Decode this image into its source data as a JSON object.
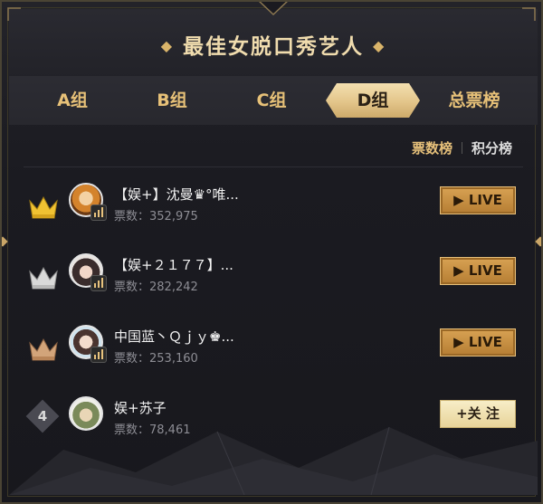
{
  "title": "最佳女脱口秀艺人",
  "tabs": [
    {
      "label": "A组",
      "active": false
    },
    {
      "label": "B组",
      "active": false
    },
    {
      "label": "C组",
      "active": false
    },
    {
      "label": "D组",
      "active": true
    },
    {
      "label": "总票榜",
      "active": false
    }
  ],
  "subtabs": [
    {
      "label": "票数榜",
      "active": true
    },
    {
      "label": "积分榜",
      "active": false
    }
  ],
  "colors": {
    "gold": "#e7c178",
    "gold_rank": "#f0c232",
    "silver_rank": "#d9d9d9",
    "bronze_rank": "#d2a47a"
  },
  "entries": [
    {
      "rank": "1",
      "rank_icon": "crown-gold-icon",
      "name": "【娱+】沈曼♛°唯...",
      "votes_label": "票数：352,975",
      "button": "LIVE"
    },
    {
      "rank": "2",
      "rank_icon": "crown-silver-icon",
      "name": "【娱+２１７７】...",
      "votes_label": "票数：282,242",
      "button": "LIVE"
    },
    {
      "rank": "3",
      "rank_icon": "crown-bronze-icon",
      "name": "中国蓝丶Ｑｊｙ♚...",
      "votes_label": "票数：253,160",
      "button": "LIVE"
    },
    {
      "rank": "4",
      "rank_icon": "rank-diamond-icon",
      "name": "娱+苏子",
      "votes_label": "票数：78,461",
      "button": "+关 注"
    }
  ]
}
